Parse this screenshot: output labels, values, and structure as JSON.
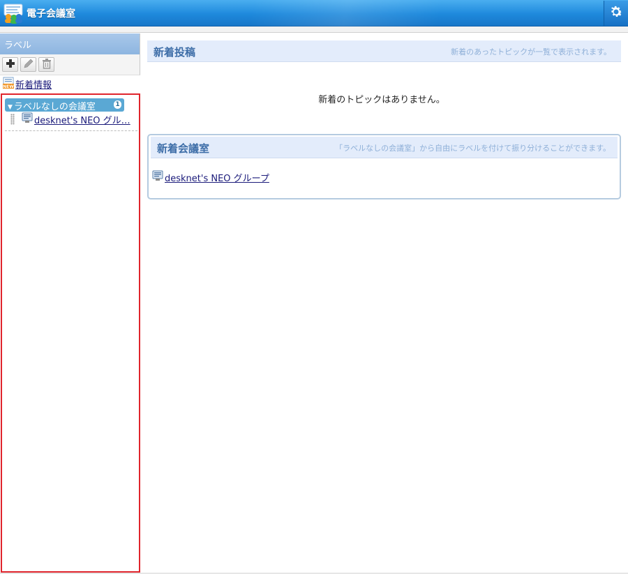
{
  "app": {
    "title": "電子会議室",
    "colors": {
      "titlebar": "#1e89dc",
      "label_highlight": "#5aa8d4",
      "accent_border": "#e0242c"
    },
    "icons": {
      "app": "conference-app-icon",
      "settings": "gear-icon"
    }
  },
  "sidebar": {
    "header": "ラベル",
    "toolbar": {
      "add_icon": "plus-icon",
      "edit_icon": "pencil-icon",
      "delete_icon": "trash-icon"
    },
    "new_info_link": "新着情報",
    "labels": [
      {
        "name": "ラベルなしの会議室",
        "count": "1",
        "rooms": [
          "desknet's NEO グル…"
        ]
      }
    ]
  },
  "main": {
    "new_posts": {
      "title": "新着投稿",
      "description": "新着のあったトピックが一覧で表示されます。",
      "empty_message": "新着のトピックはありません。"
    },
    "new_rooms": {
      "title": "新着会議室",
      "description": "「ラベルなしの会議室」から自由にラベルを付けて振り分けることができます。",
      "items": [
        "desknet's NEO グループ"
      ]
    }
  }
}
